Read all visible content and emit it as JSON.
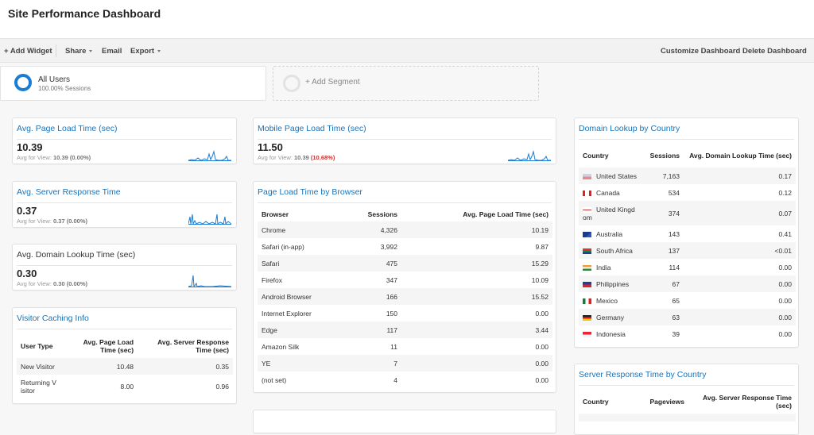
{
  "header": {
    "title": "Site Performance Dashboard"
  },
  "toolbar": {
    "add_widget": "+ Add Widget",
    "share": "Share",
    "email": "Email",
    "export": "Export",
    "customize": "Customize Dashboard",
    "delete": "Delete Dashboard"
  },
  "segments": {
    "active": {
      "name": "All Users",
      "sub": "100.00% Sessions",
      "color": "#1a7cd3"
    },
    "add_label": "+ Add Segment"
  },
  "metrics": {
    "page_load": {
      "title": "Avg. Page Load Time (sec)",
      "value": "10.39",
      "avg_prefix": "Avg for View:",
      "avg_value": "10.39",
      "avg_delta": "(0.00%)"
    },
    "server_response": {
      "title": "Avg. Server Response Time",
      "value": "0.37",
      "avg_prefix": "Avg for View:",
      "avg_value": "0.37",
      "avg_delta": "(0.00%)"
    },
    "domain_lookup": {
      "title": "Avg. Domain Lookup Time (sec)",
      "value": "0.30",
      "avg_prefix": "Avg for View:",
      "avg_value": "0.30",
      "avg_delta": "(0.00%)"
    },
    "mobile_load": {
      "title": "Mobile Page Load Time (sec)",
      "value": "11.50",
      "avg_prefix": "Avg for View:",
      "avg_value": "10.39",
      "avg_delta": "(10.68%)",
      "delta_color": "#cc3333"
    }
  },
  "visitor_caching": {
    "title": "Visitor Caching Info",
    "columns": [
      "User Type",
      "Avg. Page Load Time (sec)",
      "Avg. Server Response Time (sec)"
    ],
    "rows": [
      [
        "New Visitor",
        "10.48",
        "0.35"
      ],
      [
        "Returning V isitor",
        "8.00",
        "0.96"
      ]
    ]
  },
  "browser_table": {
    "title": "Page Load Time by Browser",
    "columns": [
      "Browser",
      "Sessions",
      "Avg. Page Load Time (sec)"
    ],
    "rows": [
      [
        "Chrome",
        "4,326",
        "10.19"
      ],
      [
        "Safari (in-app)",
        "3,992",
        "9.87"
      ],
      [
        "Safari",
        "475",
        "15.29"
      ],
      [
        "Firefox",
        "347",
        "10.09"
      ],
      [
        "Android Browser",
        "166",
        "15.52"
      ],
      [
        "Internet Explorer",
        "150",
        "0.00"
      ],
      [
        "Edge",
        "117",
        "3.44"
      ],
      [
        "Amazon Silk",
        "11",
        "0.00"
      ],
      [
        "YE",
        "7",
        "0.00"
      ],
      [
        "(not set)",
        "4",
        "0.00"
      ]
    ]
  },
  "domain_by_country": {
    "title": "Domain Lookup by Country",
    "columns": [
      "Country",
      "Sessions",
      "Avg. Domain Lookup Time (sec)"
    ],
    "rows": [
      {
        "flag": "us-flag",
        "country": "United States",
        "sessions": "7,163",
        "value": "0.17"
      },
      {
        "flag": "ca-flag",
        "country": "Canada",
        "sessions": "534",
        "value": "0.12"
      },
      {
        "flag": "gb-flag",
        "country": "United Kingdom",
        "sessions": "374",
        "value": "0.07"
      },
      {
        "flag": "au-flag",
        "country": "Australia",
        "sessions": "143",
        "value": "0.41"
      },
      {
        "flag": "za-flag",
        "country": "South Africa",
        "sessions": "137",
        "value": "<0.01"
      },
      {
        "flag": "in-flag",
        "country": "India",
        "sessions": "114",
        "value": "0.00"
      },
      {
        "flag": "ph-flag",
        "country": "Philippines",
        "sessions": "67",
        "value": "0.00"
      },
      {
        "flag": "mx-flag",
        "country": "Mexico",
        "sessions": "65",
        "value": "0.00"
      },
      {
        "flag": "de-flag",
        "country": "Germany",
        "sessions": "63",
        "value": "0.00"
      },
      {
        "flag": "id-flag",
        "country": "Indonesia",
        "sessions": "39",
        "value": "0.00"
      }
    ]
  },
  "server_by_country": {
    "title": "Server Response Time by Country",
    "columns": [
      "Country",
      "Pageviews",
      "Avg. Server Response Time (sec)"
    ]
  }
}
